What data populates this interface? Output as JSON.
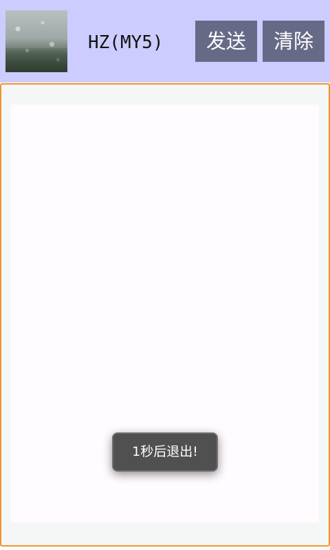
{
  "header": {
    "avatar_icon": "rainy-window-photo",
    "title": "HZ(MY5)",
    "send_label": "发送",
    "clear_label": "清除"
  },
  "content": {
    "text": ""
  },
  "toast": {
    "message": "1秒后退出!"
  },
  "colors": {
    "header_bg": "#ccccff",
    "button_bg": "#666a86",
    "frame_border": "#f0952a",
    "toast_bg": "#505050"
  }
}
